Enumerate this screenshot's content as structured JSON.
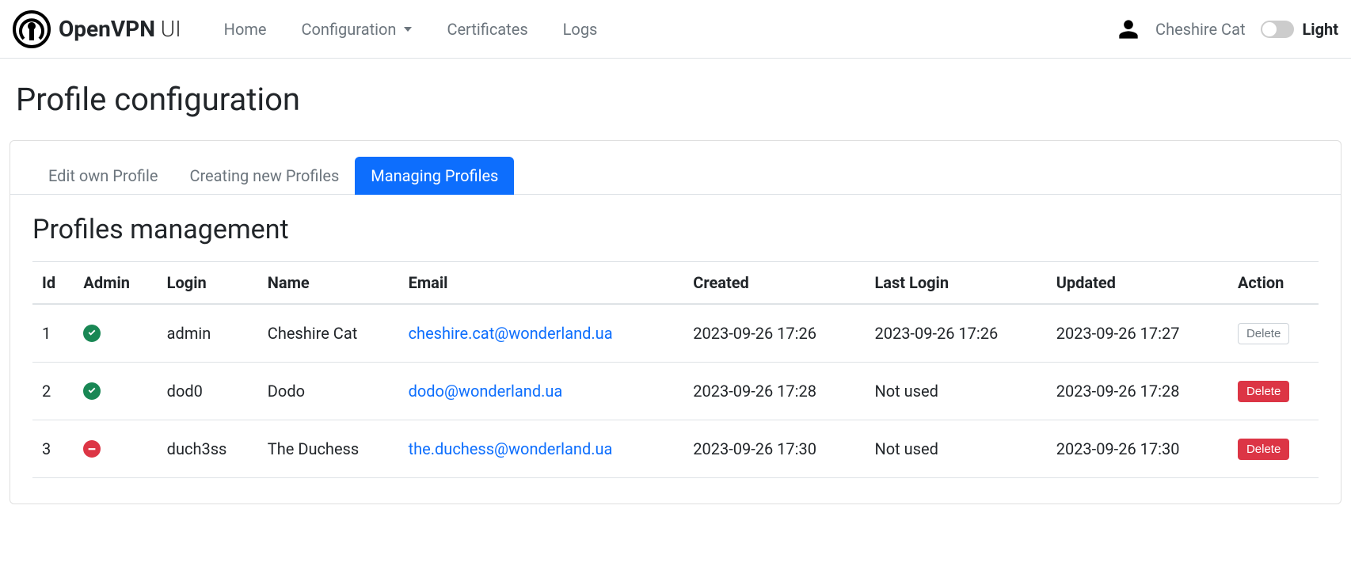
{
  "brand": {
    "bold": "OpenVPN",
    "light": " UI"
  },
  "nav": {
    "home": "Home",
    "configuration": "Configuration",
    "certificates": "Certificates",
    "logs": "Logs"
  },
  "user": {
    "name": "Cheshire Cat"
  },
  "theme": {
    "label": "Light"
  },
  "page": {
    "title": "Profile configuration"
  },
  "tabs": {
    "edit_own": "Edit own Profile",
    "creating": "Creating new Profiles",
    "managing": "Managing Profiles"
  },
  "section": {
    "title": "Profiles management"
  },
  "table": {
    "headers": {
      "id": "Id",
      "admin": "Admin",
      "login": "Login",
      "name": "Name",
      "email": "Email",
      "created": "Created",
      "last_login": "Last Login",
      "updated": "Updated",
      "action": "Action"
    },
    "rows": [
      {
        "id": "1",
        "admin": true,
        "login": "admin",
        "name": "Cheshire Cat",
        "email": "cheshire.cat@wonderland.ua",
        "created": "2023-09-26 17:26",
        "last_login": "2023-09-26 17:26",
        "updated": "2023-09-26 17:27",
        "delete_style": "outline",
        "delete_label": "Delete"
      },
      {
        "id": "2",
        "admin": true,
        "login": "dod0",
        "name": "Dodo",
        "email": "dodo@wonderland.ua",
        "created": "2023-09-26 17:28",
        "last_login": "Not used",
        "updated": "2023-09-26 17:28",
        "delete_style": "danger",
        "delete_label": "Delete"
      },
      {
        "id": "3",
        "admin": false,
        "login": "duch3ss",
        "name": "The Duchess",
        "email": "the.duchess@wonderland.ua",
        "created": "2023-09-26 17:30",
        "last_login": "Not used",
        "updated": "2023-09-26 17:30",
        "delete_style": "danger",
        "delete_label": "Delete"
      }
    ]
  }
}
